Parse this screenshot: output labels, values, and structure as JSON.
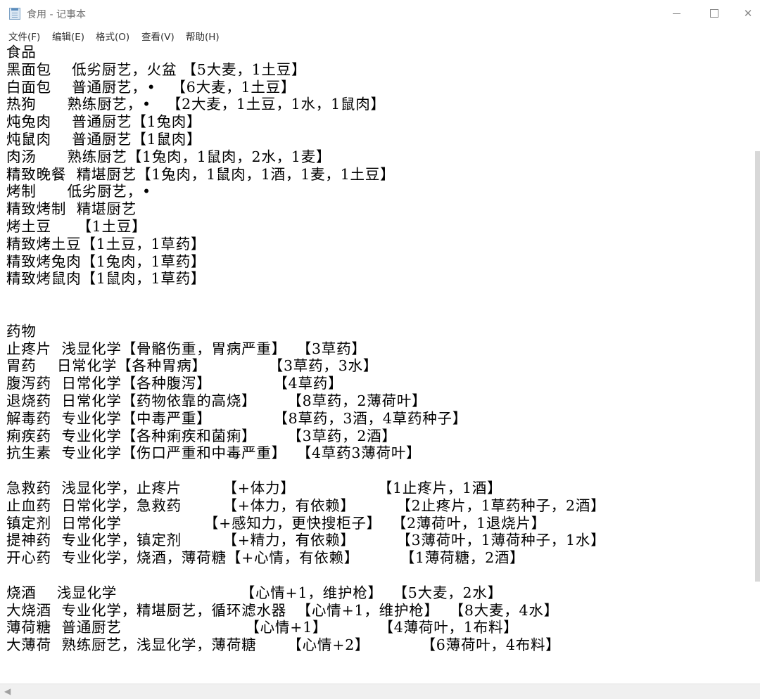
{
  "window": {
    "title": "食用 - 记事本",
    "close_glyph": "✕"
  },
  "menu": {
    "file": "文件(F)",
    "edit": "编辑(E)",
    "format": "格式(O)",
    "view": "查看(V)",
    "help": "帮助(H)"
  },
  "content": {
    "lines": [
      "食品",
      "黑面包    低劣厨艺，火盆 【5大麦，1土豆】",
      "白面包    普通厨艺，•   【6大麦，1土豆】",
      "热狗      熟练厨艺，•   【2大麦，1土豆，1水，1鼠肉】",
      "炖兔肉    普通厨艺【1兔肉】",
      "炖鼠肉    普通厨艺【1鼠肉】",
      "肉汤      熟练厨艺【1兔肉，1鼠肉，2水，1麦】",
      "精致晚餐  精堪厨艺【1兔肉，1鼠肉，1酒，1麦，1土豆】",
      "烤制      低劣厨艺，•",
      "精致烤制  精堪厨艺",
      "烤土豆     【1土豆】",
      "精致烤土豆【1土豆，1草药】",
      "精致烤兔肉【1兔肉，1草药】",
      "精致烤鼠肉【1鼠肉，1草药】",
      "",
      "",
      "药物",
      "止疼片  浅显化学【骨骼伤重，胃病严重】  【3草药】",
      "胃药    日常化学【各种胃病】            【3草药，3水】",
      "腹泻药  日常化学【各种腹泻】            【4草药】",
      "退烧药  日常化学【药物依靠的高烧】      【8草药，2薄荷叶】",
      "解毒药  专业化学【中毒严重】            【8草药，3酒，4草药种子】",
      "痢疾药  专业化学【各种痢疾和菌痢】      【3草药，2酒】",
      "抗生素  专业化学【伤口严重和中毒严重】  【4草药3薄荷叶】",
      "",
      "急救药  浅显化学，止疼片        【+体力】                【1止疼片，1酒】",
      "止血药  日常化学，急救药        【+体力，有依赖】        【2止疼片，1草药种子，2酒】",
      "镇定剂  日常化学                【+感知力，更快搜柜子】  【2薄荷叶，1退烧片】",
      "提神药  专业化学，镇定剂        【+精力，有依赖】        【3薄荷叶，1薄荷种子，1水】",
      "开心药  专业化学，烧酒，薄荷糖【+心情，有依赖】        【1薄荷糖，2酒】",
      "",
      "烧酒    浅显化学                        【心情+1，维护枪】  【5大麦，2水】",
      "大烧酒  专业化学，精堪厨艺，循环滤水器  【心情+1，维护枪】  【8大麦，4水】",
      "薄荷糖  普通厨艺                        【心情+1】          【4薄荷叶，1布料】",
      "大薄荷  熟练厨艺，浅显化学，薄荷糖      【心情+2】          【6薄荷叶，4布料】"
    ]
  }
}
